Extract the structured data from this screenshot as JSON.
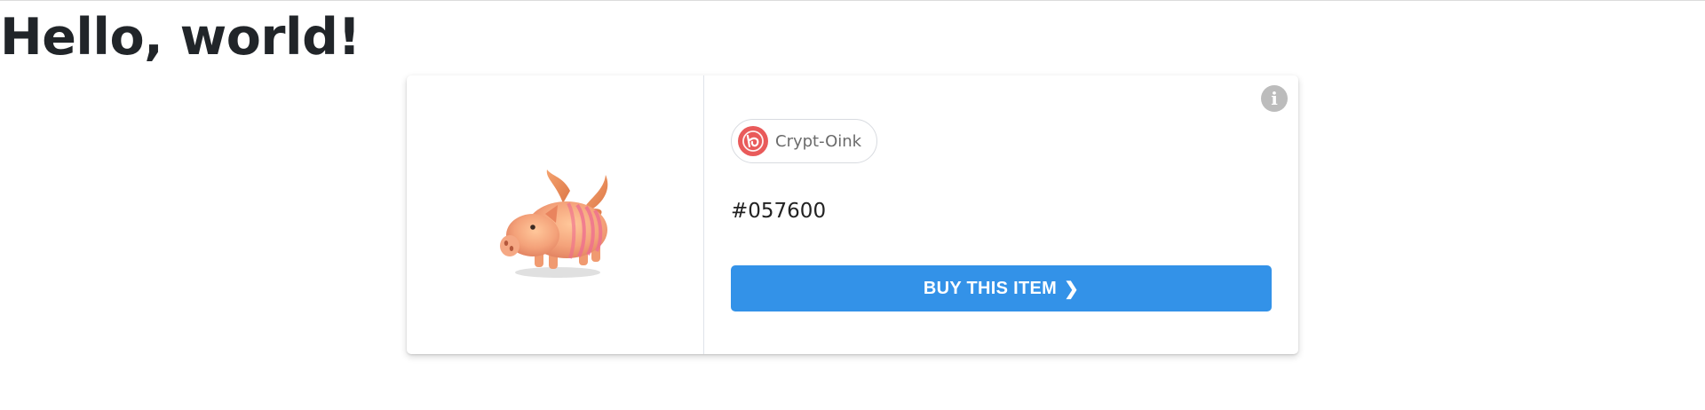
{
  "page": {
    "title": "Hello, world!"
  },
  "card": {
    "info_icon": "info-icon",
    "info_glyph": "i",
    "collection": {
      "name": "Crypt-Oink",
      "logo_icon": "crypt-oink-logo-icon"
    },
    "item_id": "#057600",
    "buy_label": "BUY THIS ITEM",
    "buy_icon": "chevron-right-icon",
    "buy_glyph": "❯",
    "image": "pink-pig-with-wings"
  },
  "colors": {
    "accent": "#3392e8",
    "logo": "#e95a5a",
    "info": "#bcbcbc"
  }
}
